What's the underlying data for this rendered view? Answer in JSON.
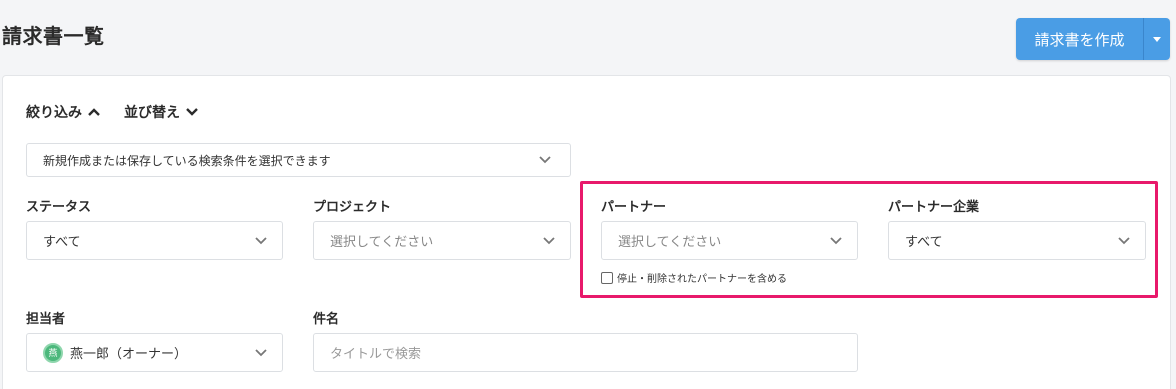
{
  "header": {
    "title": "請求書一覧",
    "create_button": "請求書を作成"
  },
  "filters": {
    "narrow_label": "絞り込み",
    "sort_label": "並び替え",
    "saved_condition_placeholder": "新規作成または保存している検索条件を選択できます",
    "status": {
      "label": "ステータス",
      "value": "すべて"
    },
    "project": {
      "label": "プロジェクト",
      "placeholder": "選択してください"
    },
    "partner": {
      "label": "パートナー",
      "placeholder": "選択してください"
    },
    "partner_company": {
      "label": "パートナー企業",
      "value": "すべて"
    },
    "include_stopped_label": "停止・削除されたパートナーを含める",
    "assignee": {
      "label": "担当者",
      "value": "燕一郎（オーナー）",
      "avatar_text": "燕"
    },
    "subject": {
      "label": "件名",
      "placeholder": "タイトルで検索"
    }
  },
  "colors": {
    "primary": "#4a9de5",
    "highlight": "#e8196b",
    "avatar": "#4cb87c"
  },
  "icons": {
    "chevron_up": "chevron-up-icon",
    "chevron_down": "chevron-down-icon"
  }
}
